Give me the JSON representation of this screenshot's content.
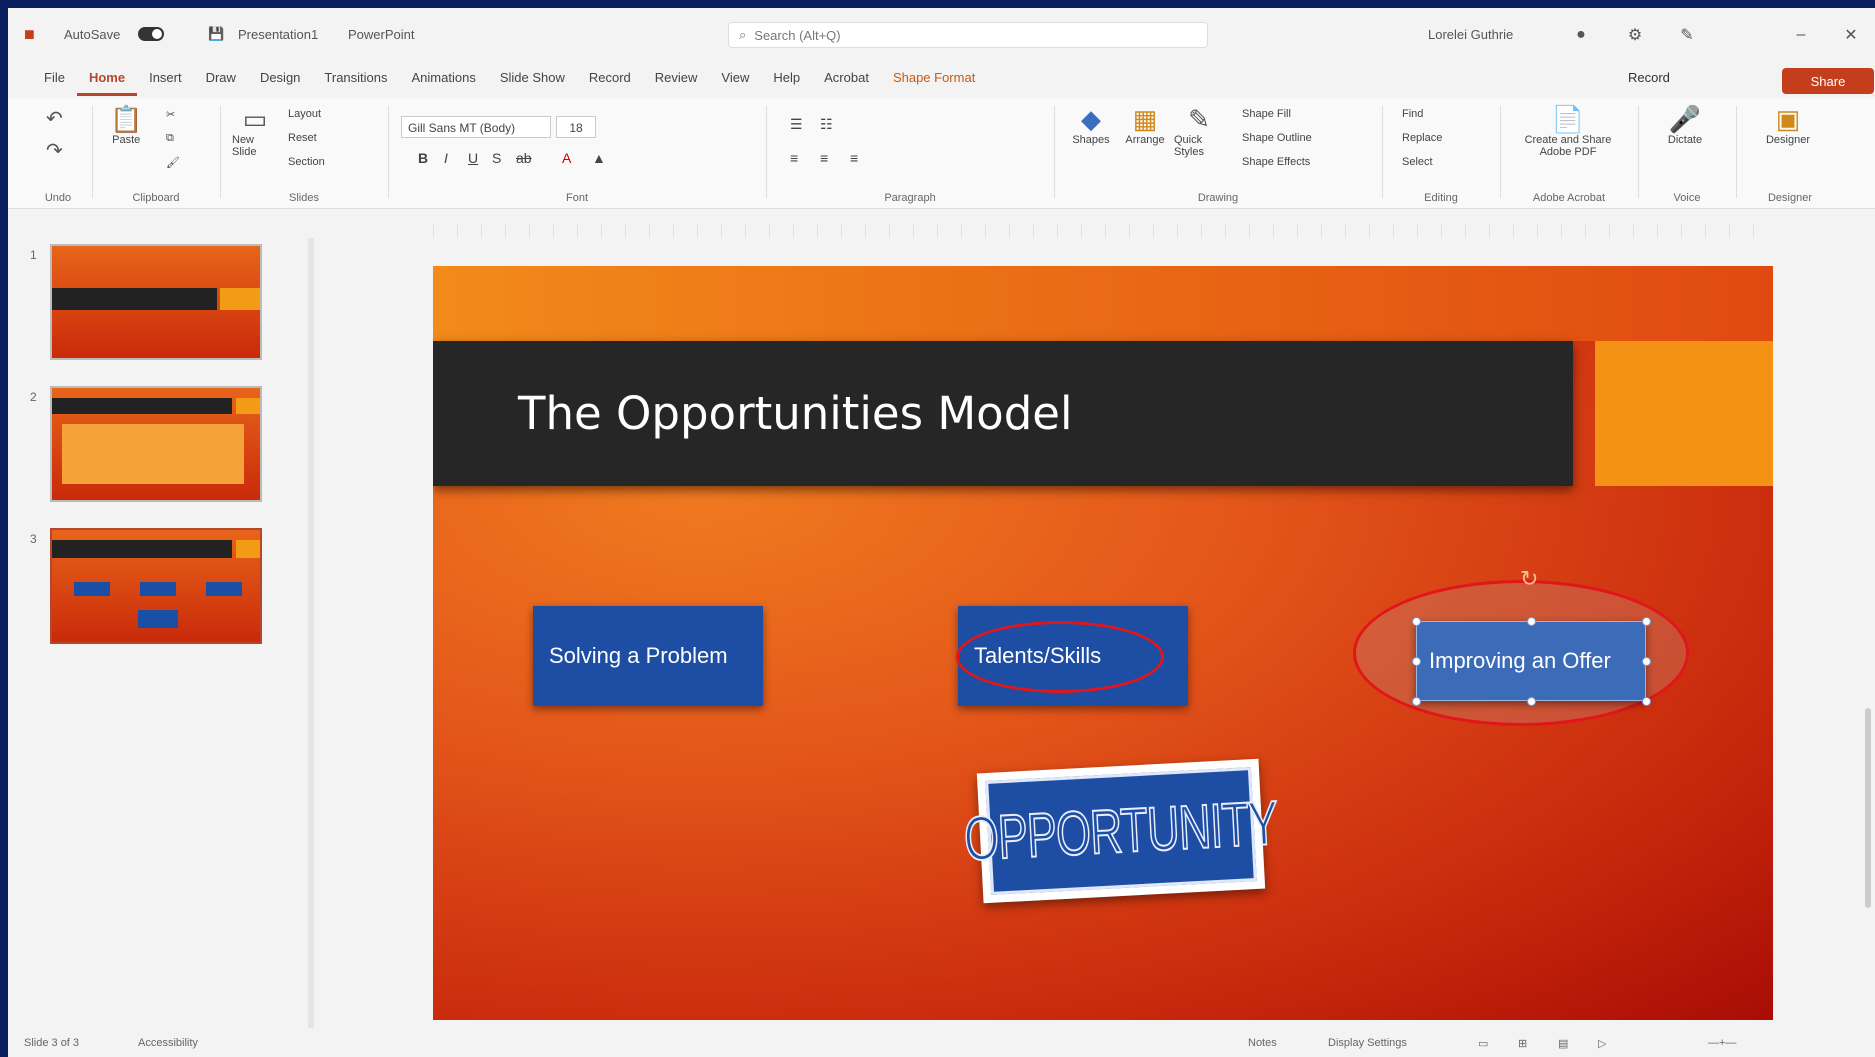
{
  "titlebar": {
    "autosave": "AutoSave",
    "filename": "Presentation1",
    "app": "PowerPoint",
    "search_placeholder": "Search (Alt+Q)",
    "user": "Lorelei Guthrie"
  },
  "menu": {
    "tabs": [
      "File",
      "Home",
      "Insert",
      "Draw",
      "Design",
      "Transitions",
      "Animations",
      "Slide Show",
      "Record",
      "Review",
      "View",
      "Help",
      "Acrobat",
      "Shape Format"
    ],
    "active": "Home",
    "record_label": "Record",
    "share_label": "Share"
  },
  "ribbon": {
    "groups": [
      "Undo",
      "Clipboard",
      "Slides",
      "Font",
      "Paragraph",
      "Drawing",
      "Editing",
      "Adobe Acrobat",
      "Voice",
      "Designer"
    ],
    "paste": "Paste",
    "new_slide": "New Slide",
    "layout": "Layout",
    "reset": "Reset",
    "section": "Section",
    "font_name": "Gill Sans MT (Body)",
    "font_size": "18",
    "shapes": "Shapes",
    "arrange": "Arrange",
    "quick_styles": "Quick Styles",
    "shape_fill": "Shape Fill",
    "shape_outline": "Shape Outline",
    "shape_effects": "Shape Effects",
    "find": "Find",
    "replace": "Replace",
    "select": "Select",
    "create_pdf": "Create and Share Adobe PDF",
    "dictate": "Dictate",
    "designer": "Designer"
  },
  "thumbnails": [
    "1",
    "2",
    "3"
  ],
  "slide": {
    "title": "The Opportunities Model",
    "box1": "Solving a Problem",
    "box2": "Talents/Skills",
    "box3": "Improving an Offer",
    "stamp": "OPPORTUNITY"
  },
  "status": {
    "slide_info": "Slide 3 of 3",
    "accessibility": "Accessibility",
    "notes": "Notes",
    "display": "Display Settings"
  },
  "colors": {
    "accent": "#b7472a",
    "slide_orange": "#e4571a",
    "box_blue": "#1d4ea3",
    "highlight_red": "#e1161b"
  }
}
